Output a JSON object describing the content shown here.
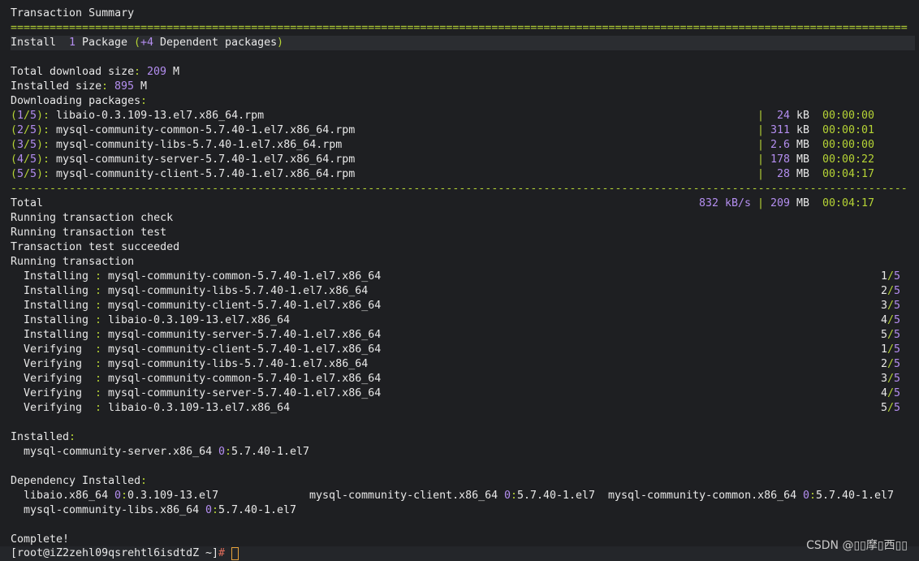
{
  "terminal": {
    "summary_title": "Transaction Summary",
    "eq_sep": "=====================================================================================================================================================================",
    "dash_sep": "---------------------------------------------------------------------------------------------------------------------------------------------------------------------",
    "install_word": "Install",
    "install_count": "1",
    "install_pkg": "Package",
    "install_dep_open": "(",
    "install_dep_plus": "+4",
    "install_dep_text": "Dependent packages",
    "install_dep_close": ")",
    "dl_size_label": "Total download size",
    "dl_size_value": "209",
    "dl_size_unit": "M",
    "inst_size_label": "Installed size",
    "inst_size_value": "895",
    "inst_size_unit": "M",
    "downloading_label": "Downloading packages",
    "downloads": [
      {
        "idx": "1",
        "name": "libaio-0.3.109-13.el7.x86_64.rpm",
        "size": "24",
        "unit": "kB",
        "time": "00:00:00"
      },
      {
        "idx": "2",
        "name": "mysql-community-common-5.7.40-1.el7.x86_64.rpm",
        "size": "311",
        "unit": "kB",
        "time": "00:00:01"
      },
      {
        "idx": "3",
        "name": "mysql-community-libs-5.7.40-1.el7.x86_64.rpm",
        "size": "2.6",
        "unit": "MB",
        "time": "00:00:00"
      },
      {
        "idx": "4",
        "name": "mysql-community-server-5.7.40-1.el7.x86_64.rpm",
        "size": "178",
        "unit": "MB",
        "time": "00:00:22"
      },
      {
        "idx": "5",
        "name": "mysql-community-client-5.7.40-1.el7.x86_64.rpm",
        "size": "28",
        "unit": "MB",
        "time": "00:04:17"
      }
    ],
    "download_total": "5",
    "total_label": "Total",
    "total_rate": "832",
    "total_rate_unit": "kB/s",
    "total_size": "209",
    "total_size_unit": "MB",
    "total_time": "00:04:17",
    "status_lines": [
      "Running transaction check",
      "Running transaction test",
      "Transaction test succeeded",
      "Running transaction"
    ],
    "steps": [
      {
        "action": "Installing",
        "pkg": "mysql-community-common-5.7.40-1.el7.x86_64",
        "n": "1"
      },
      {
        "action": "Installing",
        "pkg": "mysql-community-libs-5.7.40-1.el7.x86_64",
        "n": "2"
      },
      {
        "action": "Installing",
        "pkg": "mysql-community-client-5.7.40-1.el7.x86_64",
        "n": "3"
      },
      {
        "action": "Installing",
        "pkg": "libaio-0.3.109-13.el7.x86_64",
        "n": "4"
      },
      {
        "action": "Installing",
        "pkg": "mysql-community-server-5.7.40-1.el7.x86_64",
        "n": "5"
      },
      {
        "action": "Verifying ",
        "pkg": "mysql-community-client-5.7.40-1.el7.x86_64",
        "n": "1"
      },
      {
        "action": "Verifying ",
        "pkg": "mysql-community-libs-5.7.40-1.el7.x86_64",
        "n": "2"
      },
      {
        "action": "Verifying ",
        "pkg": "mysql-community-common-5.7.40-1.el7.x86_64",
        "n": "3"
      },
      {
        "action": "Verifying ",
        "pkg": "mysql-community-server-5.7.40-1.el7.x86_64",
        "n": "4"
      },
      {
        "action": "Verifying ",
        "pkg": "libaio-0.3.109-13.el7.x86_64",
        "n": "5"
      }
    ],
    "step_total": "5",
    "installed_label": "Installed",
    "installed_pkg": "mysql-community-server.x86_64",
    "installed_epoch": "0",
    "installed_ver": "5.7.40-1.el7",
    "dep_installed_label": "Dependency Installed",
    "deps": [
      {
        "pkg": "libaio.x86_64",
        "epoch": "0",
        "ver": "0.3.109-13.el7"
      },
      {
        "pkg": "mysql-community-client.x86_64",
        "epoch": "0",
        "ver": "5.7.40-1.el7"
      },
      {
        "pkg": "mysql-community-common.x86_64",
        "epoch": "0",
        "ver": "5.7.40-1.el7"
      },
      {
        "pkg": "mysql-community-libs.x86_64",
        "epoch": "0",
        "ver": "5.7.40-1.el7"
      }
    ],
    "complete": "Complete!",
    "prompt_open": "[",
    "prompt_user_host": "root@iZ2zehl09qsrehtl6isdtdZ",
    "prompt_dir": "~",
    "prompt_close": "]",
    "prompt_symbol": "#"
  },
  "watermark": "CSDN @▯▯摩▯西▯▯",
  "colors": {
    "green": "#b5d335",
    "purple": "#b48ef0",
    "text": "#e8e8e8",
    "background": "#1e1f22"
  }
}
